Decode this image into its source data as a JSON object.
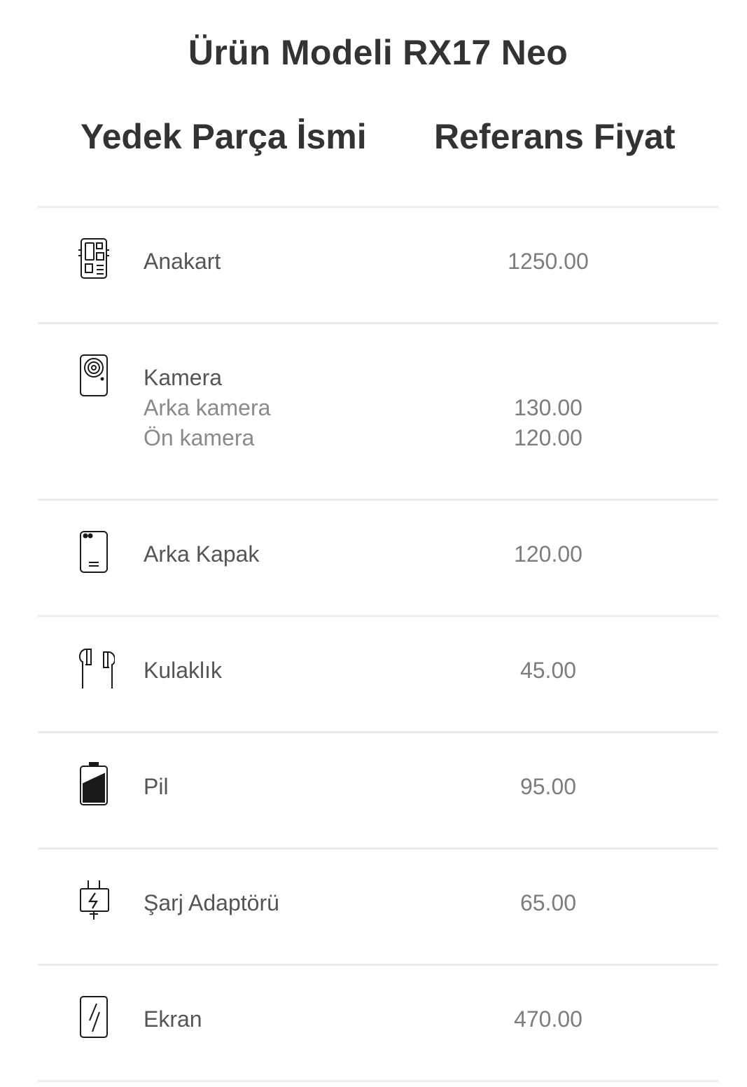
{
  "title": "Ürün Modeli RX17 Neo",
  "columns": {
    "name": "Yedek Parça İsmi",
    "price": "Referans Fiyat"
  },
  "rows": [
    {
      "icon": "motherboard-icon",
      "name": "Anakart",
      "price": "1250.00"
    },
    {
      "icon": "camera-icon",
      "name": "Kamera",
      "subitems": [
        {
          "name": "Arka kamera",
          "price": "130.00"
        },
        {
          "name": "Ön kamera",
          "price": "120.00"
        }
      ]
    },
    {
      "icon": "back-cover-icon",
      "name": "Arka Kapak",
      "price": "120.00"
    },
    {
      "icon": "earphones-icon",
      "name": "Kulaklık",
      "price": "45.00"
    },
    {
      "icon": "battery-icon",
      "name": "Pil",
      "price": "95.00"
    },
    {
      "icon": "charger-icon",
      "name": "Şarj Adaptörü",
      "price": "65.00"
    },
    {
      "icon": "screen-icon",
      "name": "Ekran",
      "price": "470.00"
    }
  ]
}
